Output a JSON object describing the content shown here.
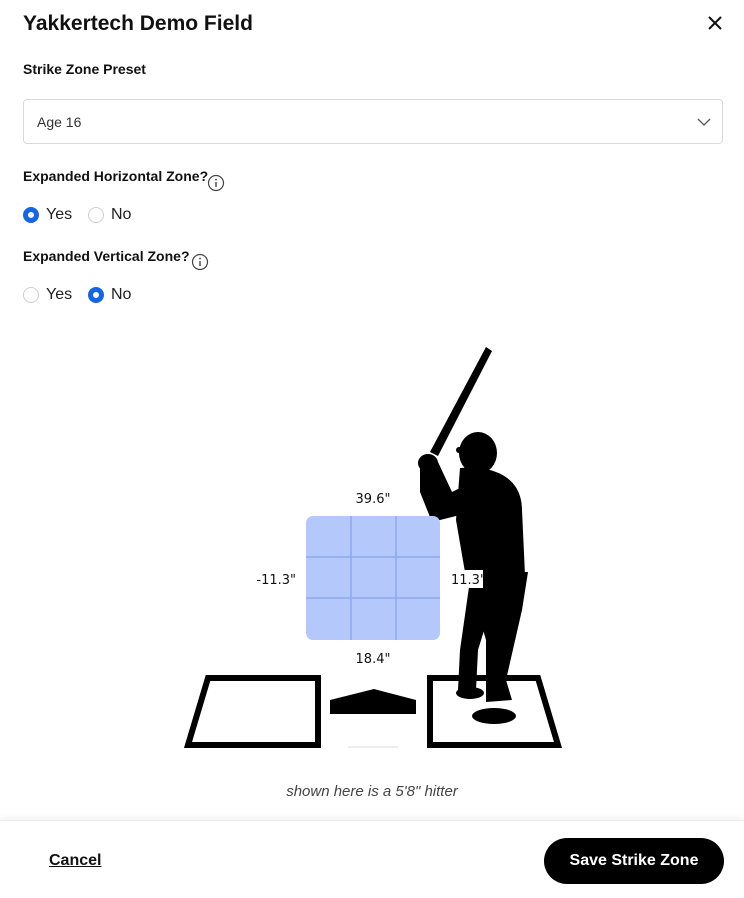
{
  "dialog": {
    "title": "Yakkertech Demo Field"
  },
  "preset": {
    "label": "Strike Zone Preset",
    "selected": "Age 16"
  },
  "horizontal": {
    "label": "Expanded Horizontal Zone?",
    "options": [
      {
        "label": "Yes",
        "checked": true
      },
      {
        "label": "No",
        "checked": false
      }
    ]
  },
  "vertical": {
    "label": "Expanded Vertical Zone?",
    "options": [
      {
        "label": "Yes",
        "checked": false
      },
      {
        "label": "No",
        "checked": true
      }
    ]
  },
  "zone": {
    "top": "39.6\"",
    "left": "-11.3\"",
    "right": "11.3\"",
    "bottom": "18.4\"",
    "fill_color": "#b4c8fb",
    "grid_color": "#8fa9ee"
  },
  "caption": "shown here is a 5'8\" hitter",
  "footer": {
    "cancel_label": "Cancel",
    "save_label": "Save Strike Zone"
  },
  "colors": {
    "accent": "#1565e8",
    "primary_button": "#000000"
  },
  "icons": {
    "close": "close-icon",
    "chevron": "chevron-down-icon",
    "info": "info-icon"
  }
}
